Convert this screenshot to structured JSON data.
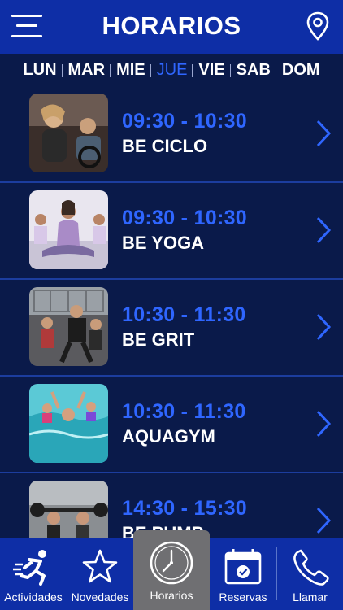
{
  "header": {
    "title": "HORARIOS"
  },
  "days": [
    {
      "label": "LUN",
      "active": false
    },
    {
      "label": "MAR",
      "active": false
    },
    {
      "label": "MIE",
      "active": false
    },
    {
      "label": "JUE",
      "active": true
    },
    {
      "label": "VIE",
      "active": false
    },
    {
      "label": "SAB",
      "active": false
    },
    {
      "label": "DOM",
      "active": false
    }
  ],
  "classes": [
    {
      "time": "09:30 - 10:30",
      "name": "BE CICLO"
    },
    {
      "time": "09:30 - 10:30",
      "name": "BE YOGA"
    },
    {
      "time": "10:30 - 11:30",
      "name": "BE GRIT"
    },
    {
      "time": "10:30 - 11:30",
      "name": "AQUAGYM"
    },
    {
      "time": "14:30 - 15:30",
      "name": "BE PUMP"
    }
  ],
  "tabs": [
    {
      "label": "Actividades",
      "icon": "running-person-icon",
      "active": false
    },
    {
      "label": "Novedades",
      "icon": "star-icon",
      "active": false
    },
    {
      "label": "Horarios",
      "icon": "clock-icon",
      "active": true
    },
    {
      "label": "Reservas",
      "icon": "calendar-check-icon",
      "active": false
    },
    {
      "label": "Llamar",
      "icon": "phone-icon",
      "active": false
    }
  ],
  "colors": {
    "header_bg": "#0e2ea6",
    "page_bg": "#0a1a4a",
    "accent": "#2f66ff",
    "active_tab_bg": "#6f6f72"
  }
}
